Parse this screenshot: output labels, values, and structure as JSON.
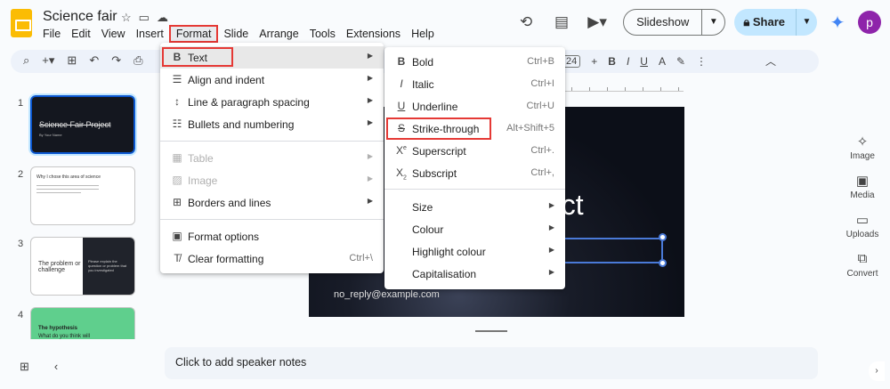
{
  "app": {
    "doc_title": "Science fair",
    "menus": [
      "File",
      "Edit",
      "View",
      "Insert",
      "Format",
      "Slide",
      "Arrange",
      "Tools",
      "Extensions",
      "Help"
    ],
    "active_menu": "Format"
  },
  "header": {
    "slideshow_label": "Slideshow",
    "share_label": "Share",
    "avatar_letter": "p"
  },
  "toolbar": {
    "font_size": "24"
  },
  "filmstrip": {
    "slides": [
      {
        "num": "1",
        "title": "Science Fair Project",
        "subtitle": "By Your Name"
      },
      {
        "num": "2",
        "title": "Why I chose this area of science"
      },
      {
        "num": "3",
        "title": "The problem or challenge",
        "body": "Please explain the question or problem that you investigated"
      },
      {
        "num": "4",
        "title": "The hypothesis",
        "body": "What do you think will"
      }
    ]
  },
  "slide": {
    "title_fragment": "ect",
    "email": "no_reply@example.com"
  },
  "notes": {
    "placeholder": "Click to add speaker notes"
  },
  "side_panel": [
    {
      "label": "Image",
      "icon": "image-sparkle-icon"
    },
    {
      "label": "Media",
      "icon": "media-icon"
    },
    {
      "label": "Uploads",
      "icon": "folder-icon"
    },
    {
      "label": "Convert",
      "icon": "convert-icon"
    }
  ],
  "format_menu": {
    "items": [
      {
        "label": "Text",
        "icon": "B",
        "submenu": true
      },
      {
        "label": "Align and indent",
        "submenu": true
      },
      {
        "label": "Line & paragraph spacing",
        "submenu": true
      },
      {
        "label": "Bullets and numbering",
        "submenu": true
      },
      {
        "label": "Table",
        "submenu": true,
        "disabled": true
      },
      {
        "label": "Image",
        "submenu": true,
        "disabled": true
      },
      {
        "label": "Borders and lines",
        "submenu": true
      },
      {
        "label": "Format options"
      },
      {
        "label": "Clear formatting",
        "shortcut": "Ctrl+\\"
      }
    ]
  },
  "text_submenu": {
    "items": [
      {
        "label": "Bold",
        "icon": "B",
        "shortcut": "Ctrl+B"
      },
      {
        "label": "Italic",
        "icon": "I",
        "shortcut": "Ctrl+I"
      },
      {
        "label": "Underline",
        "icon": "U",
        "shortcut": "Ctrl+U"
      },
      {
        "label": "Strike-through",
        "icon": "S",
        "shortcut": "Alt+Shift+5"
      },
      {
        "label": "Superscript",
        "icon": "Xe",
        "shortcut": "Ctrl+."
      },
      {
        "label": "Subscript",
        "icon": "X₂",
        "shortcut": "Ctrl+,"
      },
      {
        "label": "Size",
        "submenu": true
      },
      {
        "label": "Colour",
        "submenu": true
      },
      {
        "label": "Highlight colour",
        "submenu": true
      },
      {
        "label": "Capitalisation",
        "submenu": true
      }
    ]
  },
  "colors": {
    "highlight_box": "#e53935",
    "selection": "#0b57d0",
    "share_bg": "#c2e7ff"
  }
}
